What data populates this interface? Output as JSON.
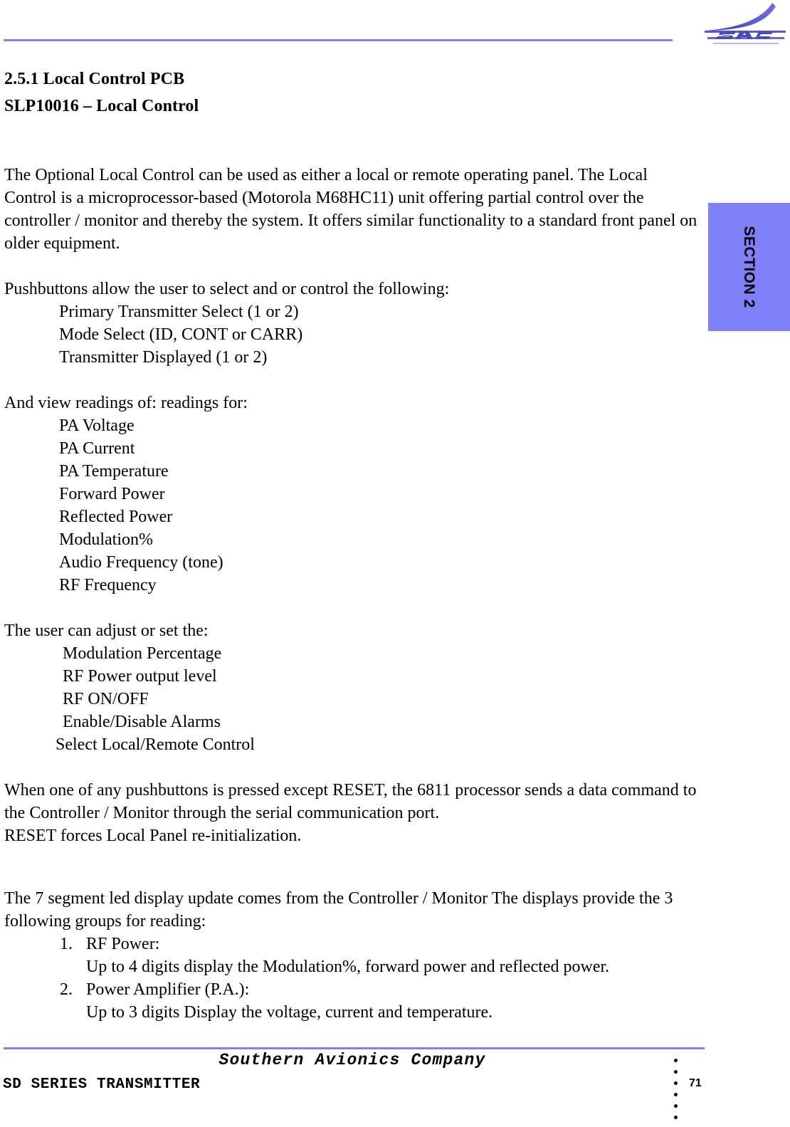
{
  "header": {
    "logo_icon": "sac-swoosh-logo",
    "logo_text": "SAC",
    "rule_color": "#8080f0"
  },
  "section_tab": {
    "label": "SECTION 2",
    "background_color": "#8080fb"
  },
  "document": {
    "heading_number": "2.5.1 Local Control PCB",
    "heading_subtitle": "SLP10016 – Local Control",
    "intro_paragraph": "The Optional Local Control can be used as either a local or remote operating panel. The Local Control is a microprocessor-based (Motorola M68HC11) unit offering partial control over the controller / monitor and thereby the system. It offers similar functionality  to a standard front panel on older equipment.",
    "pushbuttons_intro": "Pushbuttons allow  the user to select and or control the following:",
    "pushbuttons_items": [
      "Primary Transmitter Select (1 or 2)",
      "Mode Select (ID, CONT or CARR)",
      "Transmitter Displayed (1 or 2)"
    ],
    "readings_intro": "And view readings of: readings for:",
    "readings_items": [
      "PA Voltage",
      "PA Current",
      "PA Temperature",
      "Forward Power",
      "Reflected Power",
      "Modulation%",
      "Audio Frequency (tone)",
      "RF Frequency"
    ],
    "adjust_intro": "The user can adjust or set the:",
    "adjust_items": [
      "Modulation Percentage",
      "RF Power output level",
      "RF ON/OFF",
      "Enable/Disable Alarms",
      "Select Local/Remote Control"
    ],
    "pushbutton_note": " When one of any pushbuttons is pressed except RESET, the 6811 processor sends a data command to the Controller / Monitor through the serial communication port.",
    "reset_note": "RESET forces Local Panel re-initialization.",
    "display_intro": "The 7 segment led display update comes from the Controller / Monitor  The displays provide the 3 following groups for reading:",
    "display_groups": [
      {
        "marker": "1.",
        "title": "RF Power:",
        "detail": "Up to 4 digits display the Modulation%, forward power and reflected power."
      },
      {
        "marker": "2.",
        "title": "Power Amplifier (P.A.):",
        "detail": "Up to 3 digits Display the voltage, current and temperature."
      }
    ]
  },
  "footer": {
    "company": "Southern Avionics Company",
    "product": "SD SERIES TRANSMITTER",
    "page_number": "71",
    "rule_color": "#8080f0"
  }
}
